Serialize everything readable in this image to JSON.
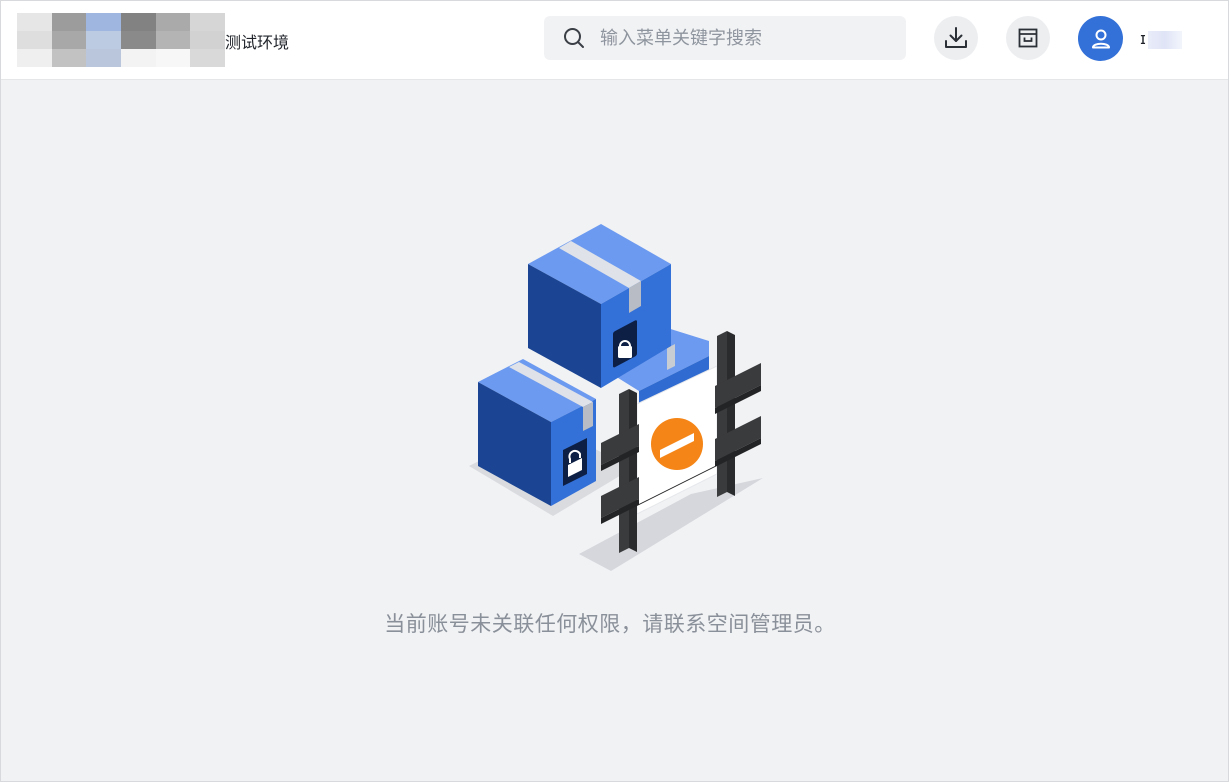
{
  "header": {
    "env_name": "测试环境",
    "search": {
      "placeholder": "输入菜单关键字搜索",
      "value": ""
    },
    "icons": {
      "search": "search-icon",
      "download": "download-icon",
      "archive": "archive-icon",
      "user": "user-icon"
    },
    "username_visible": "ɪ"
  },
  "empty_state": {
    "message": "当前账号未关联任何权限，请联系空间管理员。",
    "illustration": "locked-boxes-with-no-entry-fence"
  },
  "colors": {
    "brand_blue": "#3370d7",
    "page_bg": "#f1f2f4",
    "warning_orange": "#f58516",
    "fence": "#2f3032"
  }
}
